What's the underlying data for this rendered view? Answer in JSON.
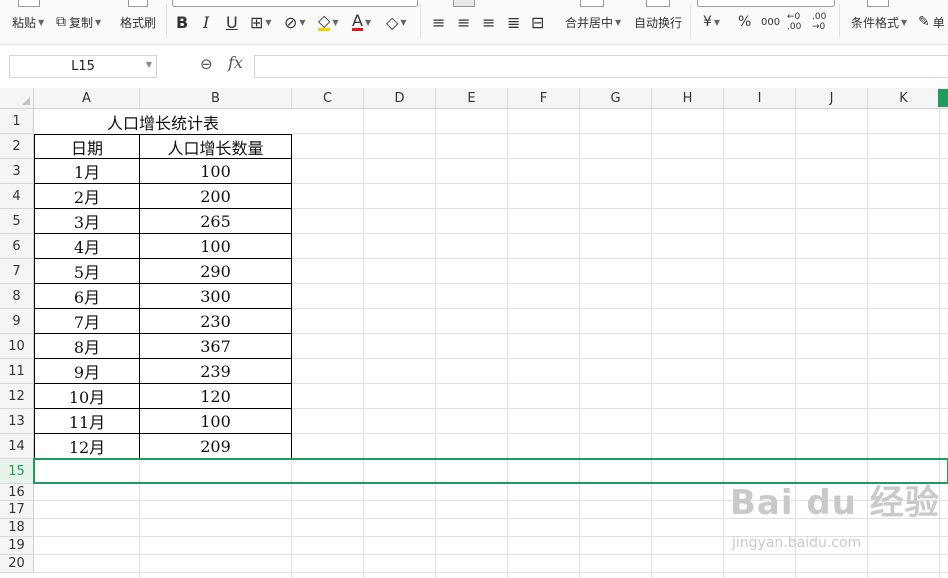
{
  "toolbar": {
    "paste": "粘贴",
    "copy": "复制",
    "format_painter": "格式刷",
    "bold": "B",
    "italic": "I",
    "underline": "U",
    "merge_center": "合并居中",
    "wrap_text": "自动换行",
    "currency": "¥",
    "percent": "%",
    "thousands": "000",
    "inc_decimal": "←0 .00",
    "dec_decimal": ".00 →0",
    "conditional_format": "条件格式",
    "cell_style_partial": "单"
  },
  "formula_bar": {
    "name_box": "L15",
    "fx": "fx",
    "content": ""
  },
  "columns": [
    "A",
    "B",
    "C",
    "D",
    "E",
    "F",
    "G",
    "H",
    "I",
    "J",
    "K"
  ],
  "rows": [
    "1",
    "2",
    "3",
    "4",
    "5",
    "6",
    "7",
    "8",
    "9",
    "10",
    "11",
    "12",
    "13",
    "14",
    "15",
    "16",
    "17",
    "18",
    "19",
    "20"
  ],
  "sheet": {
    "title": "人口增长统计表",
    "headers": [
      "日期",
      "人口增长数量"
    ],
    "data": [
      [
        "1月",
        "100"
      ],
      [
        "2月",
        "200"
      ],
      [
        "3月",
        "265"
      ],
      [
        "4月",
        "100"
      ],
      [
        "5月",
        "290"
      ],
      [
        "6月",
        "300"
      ],
      [
        "7月",
        "230"
      ],
      [
        "8月",
        "367"
      ],
      [
        "9月",
        "239"
      ],
      [
        "10月",
        "120"
      ],
      [
        "11月",
        "100"
      ],
      [
        "12月",
        "209"
      ]
    ]
  },
  "selected_row": "15",
  "watermark": {
    "brand": "Bai du 经验",
    "url": "jingyan.baidu.com"
  }
}
